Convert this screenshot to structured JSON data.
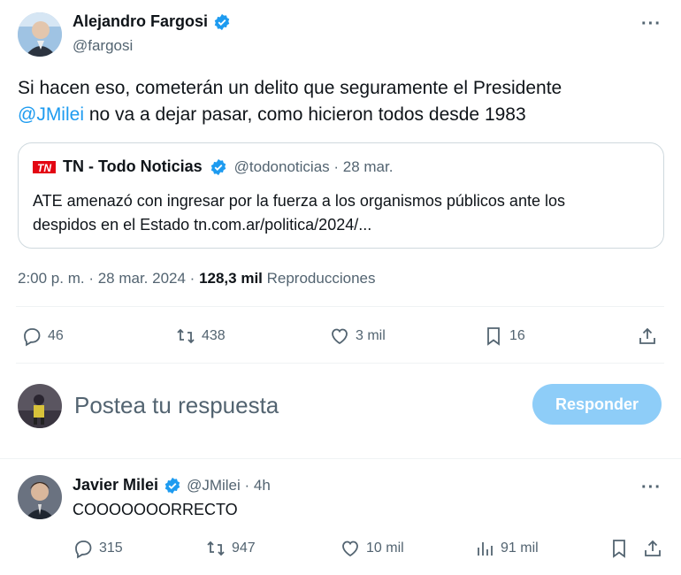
{
  "tweet": {
    "author_name": "Alejandro Fargosi",
    "author_handle": "@fargosi",
    "text_part1": "Si hacen eso, cometerán un delito que seguramente el Presidente",
    "mention": "@JMilei",
    "text_part2": " no va a dejar pasar, como hicieron todos desde 1983",
    "timestamp": "2:00 p. m. · 28 mar. 2024 ·",
    "views_count": "128,3 mil",
    "views_label": "Reproducciones",
    "replies": "46",
    "retweets": "438",
    "likes": "3 mil",
    "bookmarks": "16"
  },
  "quote": {
    "logo_text": "TN",
    "name": "TN - Todo Noticias",
    "handle_date": "@todonoticias · 28 mar.",
    "text_line1": "ATE amenazó con ingresar por la fuerza a los organismos públicos ante los",
    "text_line2": "despidos en el Estado tn.com.ar/politica/2024/..."
  },
  "compose": {
    "placeholder": "Postea tu respuesta",
    "button_label": "Responder"
  },
  "reply": {
    "author_name": "Javier Milei",
    "handle_time": "@JMilei · 4h",
    "text": "COOOOOOORRECTO",
    "replies": "315",
    "retweets": "947",
    "likes": "10 mil",
    "views": "91 mil"
  },
  "colors": {
    "accent": "#1d9bf0",
    "muted": "#536471",
    "border": "#cfd9de",
    "button_disabled": "#8ecdf8"
  }
}
